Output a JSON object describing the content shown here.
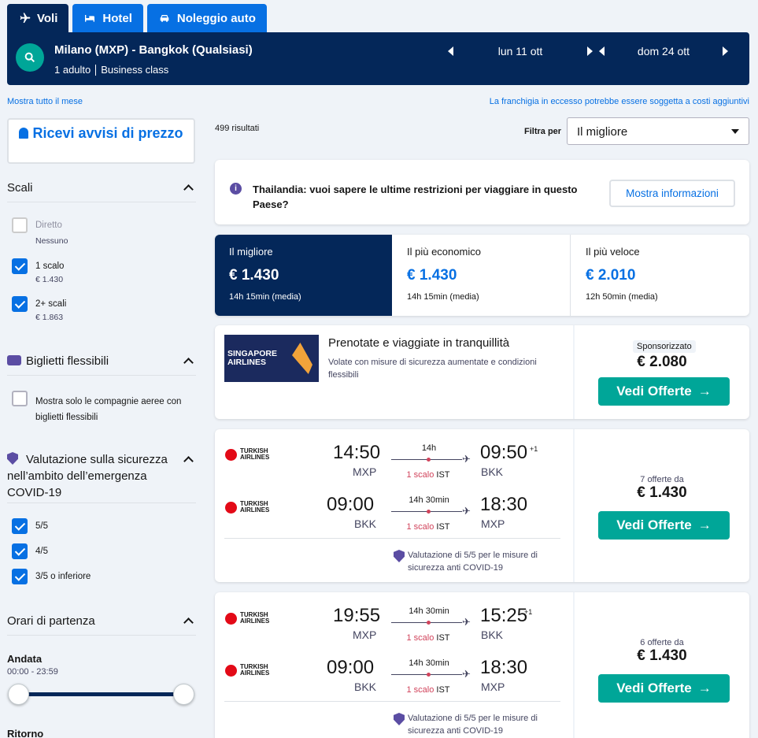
{
  "tabs": [
    {
      "label": "Voli"
    },
    {
      "label": "Hotel"
    },
    {
      "label": "Noleggio auto"
    }
  ],
  "search": {
    "route": "Milano (MXP) - Bangkok (Qualsiasi)",
    "adults": "1 adulto",
    "cabin": "Business class",
    "depart_date": "lun 11 ott",
    "return_date": "dom 24 ott"
  },
  "links": {
    "month": "Mostra tutto il mese",
    "baggage": "La franchigia in eccesso potrebbe essere soggetta a costi aggiuntivi"
  },
  "sidebar": {
    "alert_button": "Ricevi avvisi di prezzo",
    "stops": {
      "title": "Scali",
      "options": [
        {
          "label": "Diretto",
          "sub": "Nessuno",
          "checked": false
        },
        {
          "label": "1 scalo",
          "sub": "€ 1.430",
          "checked": true
        },
        {
          "label": "2+ scali",
          "sub": "€ 1.863",
          "checked": true
        }
      ]
    },
    "flex": {
      "title": "Biglietti flessibili",
      "option": "Mostra solo le compagnie aeree con biglietti flessibili"
    },
    "covid": {
      "title": "Valutazione sulla sicurezza nell’ambito dell’emergenza COVID-19",
      "options": [
        "5/5",
        "4/5",
        "3/5 o inferiore"
      ]
    },
    "times": {
      "title": "Orari di partenza",
      "outbound_label": "Andata",
      "outbound_range": "00:00 - 23:59",
      "return_label": "Ritorno"
    }
  },
  "results": {
    "count": "499 risultati",
    "filter_label": "Filtra per",
    "filter_value": "Il migliore"
  },
  "notice": {
    "text": "Thailandia: vuoi sapere le ultime restrizioni per viaggiare in questo Paese?",
    "button": "Mostra informazioni"
  },
  "sort": [
    {
      "title": "Il migliore",
      "price": "€ 1.430",
      "duration": "14h 15min (media)",
      "active": true
    },
    {
      "title": "Il più economico",
      "price": "€ 1.430",
      "duration": "14h 15min (media)",
      "active": false
    },
    {
      "title": "Il più veloce",
      "price": "€ 2.010",
      "duration": "12h 50min (media)",
      "active": false
    }
  ],
  "sponsored": {
    "airline_logo": "SINGAPORE AIRLINES",
    "title": "Prenotate e viaggiate in tranquillità",
    "desc": "Volate con misure di sicurezza aumentate e condizioni flessibili",
    "badge": "Sponsorizzato",
    "price": "€ 2.080",
    "button": "Vedi Offerte"
  },
  "flights": [
    {
      "legs": [
        {
          "dep": "14:50",
          "from": "MXP",
          "dur": "14h",
          "stops": "1 scalo",
          "via": "IST",
          "arr": "09:50",
          "plus": "+1",
          "to": "BKK"
        },
        {
          "dep": "09:00",
          "from": "BKK",
          "dur": "14h 30min",
          "stops": "1 scalo",
          "via": "IST",
          "arr": "18:30",
          "plus": "",
          "to": "MXP"
        }
      ],
      "covid": "Valutazione di 5/5 per le misure di sicurezza anti COVID-19",
      "offers": "7 offerte da",
      "price": "€ 1.430",
      "button": "Vedi Offerte"
    },
    {
      "legs": [
        {
          "dep": "19:55",
          "from": "MXP",
          "dur": "14h 30min",
          "stops": "1 scalo",
          "via": "IST",
          "arr": "15:25",
          "plus": "+1",
          "to": "BKK"
        },
        {
          "dep": "09:00",
          "from": "BKK",
          "dur": "14h 30min",
          "stops": "1 scalo",
          "via": "IST",
          "arr": "18:30",
          "plus": "",
          "to": "MXP"
        }
      ],
      "covid": "Valutazione di 5/5 per le misure di sicurezza anti COVID-19",
      "offers": "6 offerte da",
      "price": "€ 1.430",
      "button": "Vedi Offerte"
    }
  ],
  "airline_name": "TURKISH AIRLINES",
  "colors": {
    "navy": "#042759",
    "blue": "#0770e3",
    "green": "#00a698",
    "red": "#d1435b"
  }
}
